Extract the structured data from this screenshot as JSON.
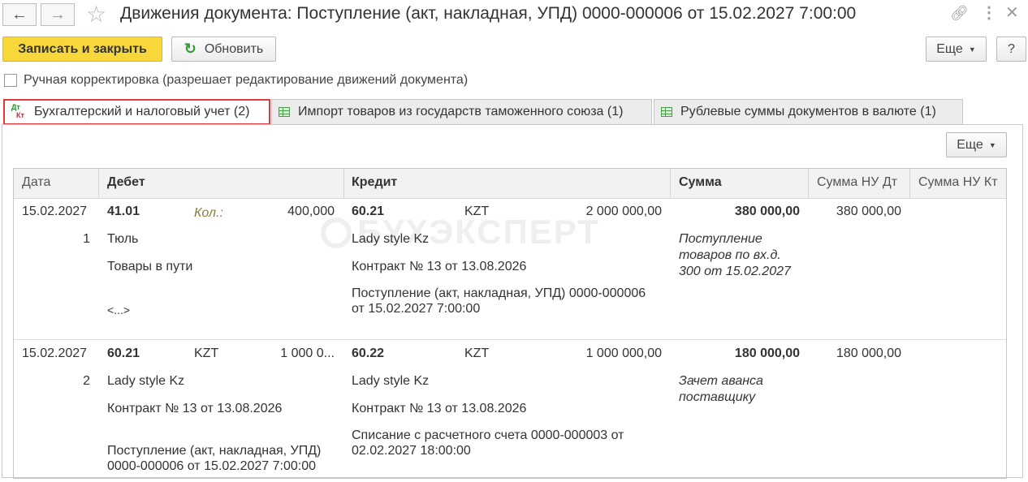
{
  "window": {
    "title": "Движения документа: Поступление (акт, накладная, УПД) 0000-000006 от 15.02.2027 7:00:00"
  },
  "icons": {
    "back": "arrow-left-icon",
    "forward": "arrow-right-icon",
    "favorite": "star-icon",
    "link": "link-icon",
    "menu": "kebab-menu-icon",
    "close": "close-icon",
    "refresh": "refresh-icon"
  },
  "toolbar": {
    "save_close_label": "Записать и закрыть",
    "refresh_label": "Обновить",
    "more_label": "Еще",
    "help_label": "?"
  },
  "manual_correction": {
    "label": "Ручная корректировка (разрешает редактирование движений документа)",
    "checked": false
  },
  "tabs": [
    {
      "label": "Бухгалтерский и налоговый учет (2)",
      "icon_text_dt": "Дт",
      "icon_text_kt": "Кт"
    },
    {
      "label": "Импорт товаров из государств таможенного союза (1)"
    },
    {
      "label": "Рублевые суммы документов в валюте (1)"
    }
  ],
  "panel": {
    "more_label": "Еще"
  },
  "watermark": "БУХЭКСПЕРТ",
  "table": {
    "columns": [
      "Дата",
      "Дебет",
      "Кредит",
      "Сумма",
      "Сумма НУ Дт",
      "Сумма НУ Кт"
    ],
    "rows": [
      {
        "date": "15.02.2027",
        "num": "1",
        "debit_account": "41.01",
        "debit_qty_label": "Кол.:",
        "debit_qty": "400,000",
        "debit_sub1": "Тюль",
        "debit_sub2": "Товары в пути",
        "debit_sub3": "<...>",
        "credit_account": "60.21",
        "credit_currency": "KZT",
        "credit_amount": "2 000 000,00",
        "credit_sub1": "Lady style Kz",
        "credit_sub2": "Контракт № 13 от 13.08.2026",
        "credit_sub3_line1": "Поступление (акт, накладная, УПД) 0000-000006",
        "credit_sub3_line2": "от 15.02.2027 7:00:00",
        "sum": "380 000,00",
        "content_line1": "Поступление",
        "content_line2": "товаров по вх.д.",
        "content_line3": "300 от 15.02.2027",
        "nu_dt": "380 000,00",
        "nu_kt": ""
      },
      {
        "date": "15.02.2027",
        "num": "2",
        "debit_account": "60.21",
        "debit_currency": "KZT",
        "debit_amount": "1 000 0...",
        "debit_sub1": "Lady style Kz",
        "debit_sub2": "Контракт № 13 от 13.08.2026",
        "debit_sub3_line1": "Поступление (акт, накладная, УПД)",
        "debit_sub3_line2": "0000-000006 от 15.02.2027 7:00:00",
        "credit_account": "60.22",
        "credit_currency": "KZT",
        "credit_amount": "1 000 000,00",
        "credit_sub1": "Lady style Kz",
        "credit_sub2": "Контракт № 13 от 13.08.2026",
        "credit_sub3_line1": "Списание с расчетного счета 0000-000003 от",
        "credit_sub3_line2": "02.02.2027 18:00:00",
        "sum": "180 000,00",
        "content_line1": "Зачет аванса",
        "content_line2": "поставщику",
        "nu_dt": "180 000,00",
        "nu_kt": ""
      }
    ]
  }
}
